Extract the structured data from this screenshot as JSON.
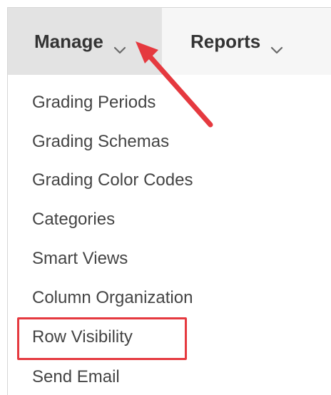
{
  "menubar": {
    "tabs": [
      {
        "label": "Manage",
        "active": true,
        "icon": "chevron-down-icon"
      },
      {
        "label": "Reports",
        "active": false,
        "icon": "chevron-down-icon"
      }
    ]
  },
  "manage_menu": {
    "items": [
      {
        "label": "Grading Periods"
      },
      {
        "label": "Grading Schemas"
      },
      {
        "label": "Grading Color Codes"
      },
      {
        "label": "Categories"
      },
      {
        "label": "Smart Views"
      },
      {
        "label": "Column Organization"
      },
      {
        "label": "Row Visibility",
        "highlighted": true
      },
      {
        "label": "Send Email"
      }
    ]
  },
  "colors": {
    "active_tab_bg": "#e3e3e3",
    "menubar_bg": "#f6f6f6",
    "text": "#444444",
    "annotation_red": "#e5393f"
  }
}
